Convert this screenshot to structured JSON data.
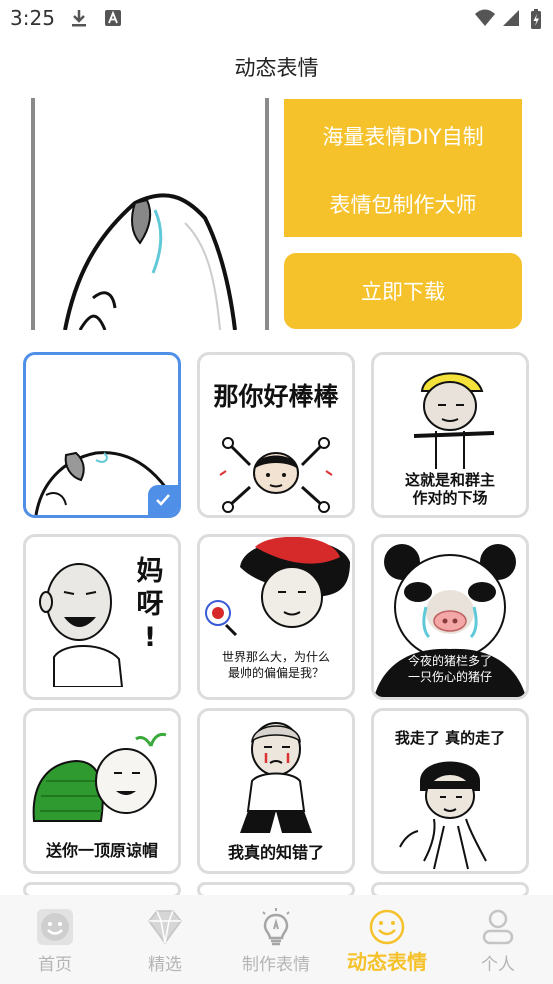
{
  "status": {
    "time": "3:25"
  },
  "page": {
    "title": "动态表情"
  },
  "promo": {
    "line1": "海量表情DIY自制",
    "line2": "表情包制作大师",
    "download_label": "立即下载"
  },
  "grid": {
    "items": [
      {
        "caption": ""
      },
      {
        "caption": "那你好棒棒"
      },
      {
        "caption": "这就是和群主\n作对的下场"
      },
      {
        "caption": "妈\n呀\n!"
      },
      {
        "caption": "世界那么大，为什么\n最帅的偏偏是我？"
      },
      {
        "caption": "今夜的猪栏多了\n一只伤心的猪仔"
      },
      {
        "caption": "送你一顶原谅帽"
      },
      {
        "caption": "我真的知错了"
      },
      {
        "caption": "我走了 真的走了"
      }
    ]
  },
  "tabbar": {
    "tabs": [
      {
        "label": "首页",
        "icon": "smiley-face-icon"
      },
      {
        "label": "精选",
        "icon": "diamond-icon"
      },
      {
        "label": "制作表情",
        "icon": "lightbulb-icon"
      },
      {
        "label": "动态表情",
        "icon": "smile-outline-icon"
      },
      {
        "label": "个人",
        "icon": "person-icon"
      }
    ],
    "active_color": "#f5c22c"
  }
}
